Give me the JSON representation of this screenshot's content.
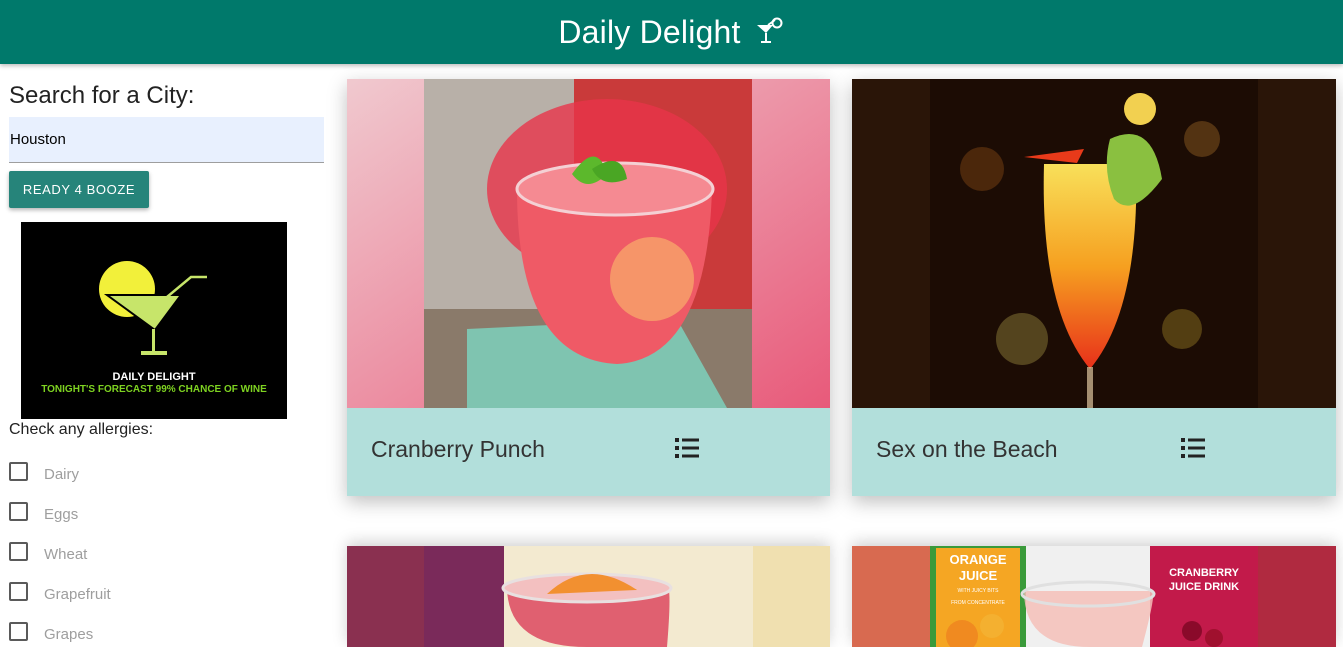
{
  "header": {
    "title": "Daily Delight",
    "icon": "cocktail-icon",
    "bg_color": "#00796b"
  },
  "search": {
    "label": "Search for a City:",
    "value": "Houston",
    "button_label": "READY 4 BOOZE"
  },
  "logo": {
    "title": "DAILY DELIGHT",
    "tagline": "TONIGHT'S FORECAST 99% CHANCE OF WINE"
  },
  "allergies": {
    "label": "Check any allergies:",
    "items": [
      {
        "label": "Dairy",
        "checked": false
      },
      {
        "label": "Eggs",
        "checked": false
      },
      {
        "label": "Wheat",
        "checked": false
      },
      {
        "label": "Grapefruit",
        "checked": false
      },
      {
        "label": "Grapes",
        "checked": false
      }
    ]
  },
  "cards": [
    {
      "title": "Cranberry Punch",
      "icon": "list-icon"
    },
    {
      "title": "Sex on the Beach",
      "icon": "list-icon"
    },
    {
      "title": "",
      "icon": "list-icon"
    },
    {
      "title": "",
      "icon": "list-icon"
    }
  ],
  "photo_labels": {
    "orange_juice": "ORANGE JUICE",
    "orange_juice_sub": "WITH JUICY BITS",
    "orange_juice_sub2": "FROM CONCENTRATE",
    "cranberry_juice": "CRANBERRY JUICE DRINK"
  },
  "colors": {
    "accent": "#26847a",
    "card_footer": "#b2dfdb",
    "input_bg": "#e8f0fe"
  }
}
